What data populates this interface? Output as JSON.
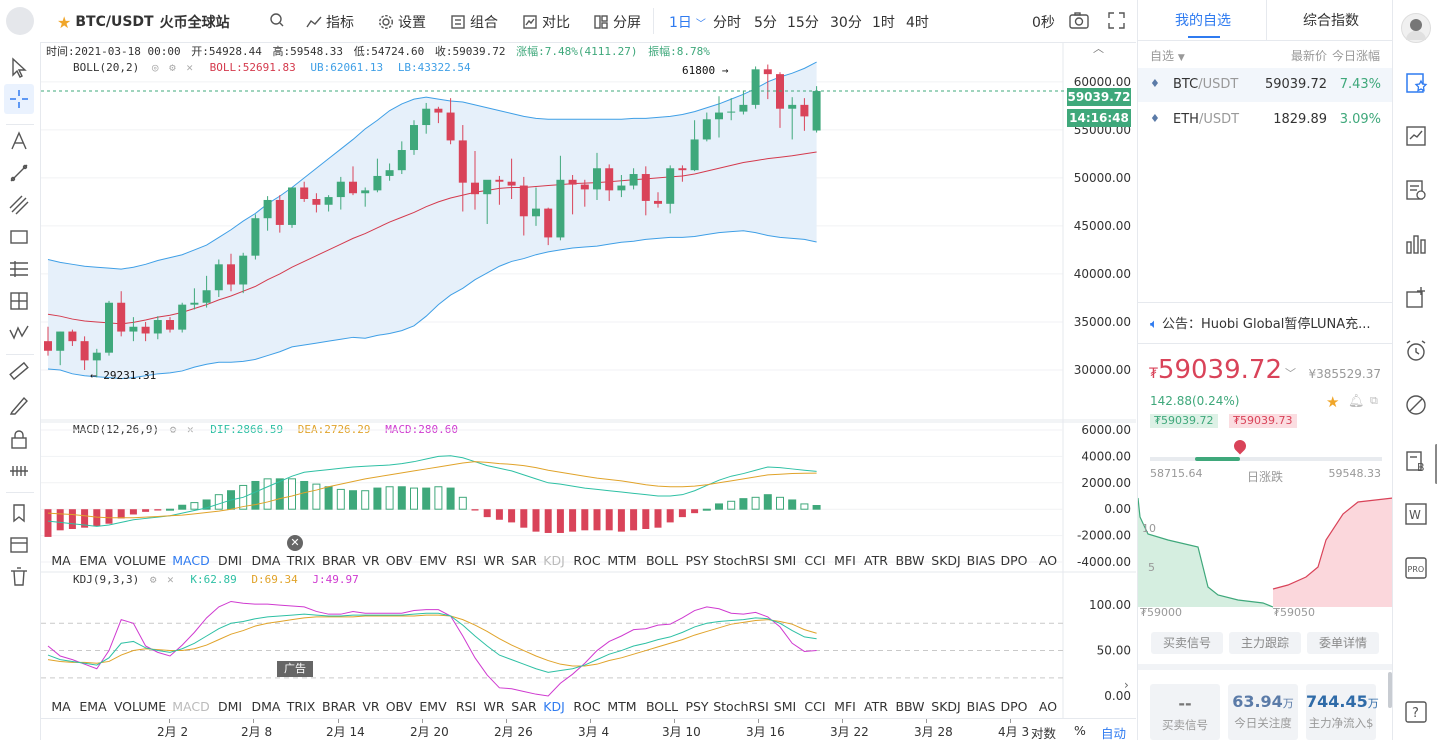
{
  "toolbar": {
    "symbol": "BTC/USDT",
    "exchange": "火币全球站",
    "indicators": "指标",
    "settings": "设置",
    "combo": "组合",
    "compare": "对比",
    "split": "分屏",
    "periods": [
      "1日",
      "分时",
      "5分",
      "15分",
      "30分",
      "1时",
      "4时"
    ],
    "active_period": "1日",
    "seconds": "0秒"
  },
  "ohlc": {
    "time": "时间:2021-03-18 00:00",
    "open": "开:54928.44",
    "high": "高:59548.33",
    "low": "低:54724.60",
    "close": "收:59039.72",
    "change": "涨幅:7.48%(4111.27)",
    "amplitude": "振幅:8.78%"
  },
  "boll": {
    "name": "BOLL(20,2)",
    "boll": "BOLL:52691.83",
    "ub": "UB:62061.13",
    "lb": "LB:43322.54"
  },
  "macd": {
    "name": "MACD(12,26,9)",
    "dif": "DIF:2866.59",
    "dea": "DEA:2726.29",
    "macd": "MACD:280.60"
  },
  "kdj": {
    "name": "KDJ(9,3,3)",
    "k": "K:62.89",
    "d": "D:69.34",
    "j": "J:49.97"
  },
  "price_axis": [
    "60000.00",
    "55000.00",
    "50000.00",
    "45000.00",
    "40000.00",
    "35000.00",
    "30000.00"
  ],
  "macd_axis": [
    "6000.00",
    "4000.00",
    "2000.00",
    "0.00",
    "-2000.00",
    "-4000.00"
  ],
  "kdj_axis": [
    "100.00",
    "50.00",
    "0.00"
  ],
  "price_label": "59039.72",
  "countdown": "14:16:48",
  "high_mark": "61800 →",
  "low_mark": "← 29231.31",
  "ad_label": "广告",
  "indicator_list": [
    "MA",
    "EMA",
    "VOLUME",
    "MACD",
    "DMI",
    "DMA",
    "TRIX",
    "BRAR",
    "VR",
    "OBV",
    "EMV",
    "RSI",
    "WR",
    "SAR",
    "KDJ",
    "ROC",
    "MTM",
    "BOLL",
    "PSY",
    "StochRSI",
    "SMI",
    "CCI",
    "MFI",
    "ATR",
    "BBW",
    "SKDJ",
    "BIAS",
    "DPO",
    "AO"
  ],
  "date_axis": [
    "2月 2",
    "2月 8",
    "2月 14",
    "2月 20",
    "2月 26",
    "3月 4",
    "3月 10",
    "3月 16",
    "3月 22",
    "3月 28",
    "4月 3"
  ],
  "bottom_right": {
    "log": "对数",
    "pct": "%",
    "auto": "自动"
  },
  "chart_data": {
    "type": "candlestick",
    "symbol": "BTC/USDT",
    "ylim": [
      25000,
      63000
    ],
    "candles": [
      [
        33000,
        34500,
        31500,
        32000
      ],
      [
        32000,
        34000,
        30500,
        34000
      ],
      [
        34000,
        34200,
        32500,
        33000
      ],
      [
        33000,
        33500,
        30000,
        31000
      ],
      [
        31000,
        32200,
        29231,
        31800
      ],
      [
        31800,
        37200,
        31500,
        37000
      ],
      [
        37000,
        38200,
        33500,
        34000
      ],
      [
        34000,
        35500,
        33000,
        34500
      ],
      [
        34500,
        35000,
        33000,
        33800
      ],
      [
        33800,
        35600,
        33200,
        35200
      ],
      [
        35200,
        35500,
        33900,
        34200
      ],
      [
        34200,
        37000,
        33900,
        36800
      ],
      [
        36800,
        38500,
        36300,
        37000
      ],
      [
        37000,
        39800,
        36500,
        38300
      ],
      [
        38300,
        41500,
        37600,
        41000
      ],
      [
        41000,
        42100,
        38200,
        38900
      ],
      [
        38900,
        42200,
        38000,
        41900
      ],
      [
        41900,
        46200,
        41500,
        45800
      ],
      [
        45800,
        48100,
        44500,
        47700
      ],
      [
        47700,
        48200,
        44300,
        45100
      ],
      [
        45100,
        49000,
        44800,
        49000
      ],
      [
        49000,
        49600,
        47500,
        47800
      ],
      [
        47800,
        48400,
        46400,
        47200
      ],
      [
        47200,
        48200,
        46500,
        48000
      ],
      [
        48000,
        50100,
        46700,
        49600
      ],
      [
        49600,
        51200,
        48200,
        48400
      ],
      [
        48400,
        49000,
        47000,
        48700
      ],
      [
        48700,
        52000,
        48500,
        50200
      ],
      [
        50200,
        51500,
        49700,
        50800
      ],
      [
        50800,
        53800,
        50400,
        52900
      ],
      [
        52900,
        56000,
        52400,
        55500
      ],
      [
        55500,
        57800,
        54600,
        57200
      ],
      [
        57200,
        57400,
        55700,
        56800
      ],
      [
        56800,
        58300,
        53500,
        53900
      ],
      [
        53900,
        55500,
        46500,
        49500
      ],
      [
        49500,
        52800,
        46700,
        48300
      ],
      [
        48300,
        49500,
        45200,
        49800
      ],
      [
        49800,
        50200,
        47200,
        49600
      ],
      [
        49600,
        52000,
        47800,
        49200
      ],
      [
        49200,
        50100,
        44000,
        46000
      ],
      [
        46000,
        49000,
        45000,
        46800
      ],
      [
        46800,
        46900,
        43000,
        43800
      ],
      [
        43800,
        52300,
        43500,
        49800
      ],
      [
        49800,
        50300,
        46200,
        49300
      ],
      [
        49300,
        49800,
        47000,
        48800
      ],
      [
        48800,
        52600,
        47700,
        51000
      ],
      [
        51000,
        51400,
        47600,
        48700
      ],
      [
        48700,
        50300,
        48000,
        49200
      ],
      [
        49200,
        51000,
        48800,
        50400
      ],
      [
        50400,
        51200,
        46100,
        47600
      ],
      [
        47600,
        48500,
        46900,
        47300
      ],
      [
        47300,
        51300,
        46300,
        51000
      ],
      [
        51000,
        51300,
        49600,
        50800
      ],
      [
        50800,
        56000,
        50700,
        54000
      ],
      [
        54000,
        56800,
        53800,
        56100
      ],
      [
        56100,
        58500,
        54200,
        56800
      ],
      [
        56800,
        58300,
        56000,
        56900
      ],
      [
        56900,
        59100,
        56600,
        57600
      ],
      [
        57600,
        61600,
        57200,
        61300
      ],
      [
        61300,
        61800,
        58200,
        60800
      ],
      [
        60800,
        61000,
        55200,
        57200
      ],
      [
        57200,
        58400,
        54000,
        57600
      ],
      [
        57600,
        58300,
        54900,
        56400
      ],
      [
        54930,
        59550,
        54720,
        59040
      ]
    ],
    "boll_mid": [
      35800,
      35600,
      35300,
      35100,
      35000,
      34900,
      34800,
      34950,
      35200,
      35500,
      35700,
      36000,
      36400,
      36800,
      37300,
      37700,
      38200,
      38700,
      39400,
      40000,
      40700,
      41300,
      41900,
      42500,
      43100,
      43700,
      44200,
      44800,
      45400,
      45900,
      46400,
      47000,
      47500,
      47900,
      48200,
      48500,
      48700,
      48900,
      49000,
      49000,
      49100,
      49200,
      49300,
      49400,
      49450,
      49500,
      49600,
      49700,
      49800,
      49900,
      50000,
      50100,
      50200,
      50400,
      50700,
      51000,
      51300,
      51600,
      51800,
      52000,
      52150,
      52300,
      52500,
      52690
    ],
    "boll_ub": [
      41500,
      41200,
      41000,
      40800,
      40700,
      40600,
      40500,
      40700,
      41000,
      41400,
      41700,
      42000,
      42500,
      43000,
      43800,
      44600,
      45500,
      46300,
      47300,
      48100,
      49000,
      50000,
      51000,
      52000,
      53000,
      54000,
      55100,
      56000,
      57000,
      57700,
      58200,
      58400,
      58200,
      58000,
      57900,
      57600,
      57300,
      57000,
      56700,
      56400,
      56200,
      56100,
      56100,
      56100,
      56100,
      56100,
      56100,
      56100,
      56200,
      56200,
      56300,
      56400,
      56600,
      56900,
      57300,
      57700,
      58200,
      58700,
      59300,
      60000,
      60500,
      60900,
      61400,
      62060
    ],
    "boll_lb": [
      30100,
      30000,
      29600,
      29400,
      29300,
      29200,
      29100,
      29200,
      29400,
      29600,
      29700,
      29900,
      30300,
      30600,
      30800,
      30800,
      30900,
      31100,
      31500,
      31900,
      32400,
      32600,
      32800,
      33000,
      33200,
      33400,
      33300,
      33600,
      33800,
      34100,
      34600,
      35600,
      36800,
      37800,
      38500,
      39400,
      40100,
      40800,
      41300,
      41600,
      42000,
      42300,
      42500,
      42700,
      42800,
      42900,
      43100,
      43300,
      43400,
      43600,
      43700,
      43800,
      43800,
      43900,
      44100,
      44300,
      44400,
      44500,
      44300,
      44000,
      43800,
      43700,
      43600,
      43320
    ],
    "macd_dif": [
      -900,
      -1000,
      -1100,
      -1200,
      -1300,
      -1200,
      -1000,
      -800,
      -700,
      -600,
      -500,
      -300,
      -100,
      100,
      400,
      700,
      900,
      1300,
      1700,
      2100,
      2500,
      2800,
      2900,
      3000,
      3100,
      3200,
      3250,
      3300,
      3350,
      3450,
      3600,
      3800,
      4000,
      4050,
      3900,
      3600,
      3300,
      3100,
      2900,
      2600,
      2300,
      2000,
      1900,
      1750,
      1600,
      1500,
      1400,
      1300,
      1200,
      1100,
      1000,
      1000,
      1100,
      1400,
      1800,
      2200,
      2500,
      2700,
      2950,
      3200,
      3150,
      3050,
      2950,
      2870
    ],
    "macd_dea": [
      -300,
      -350,
      -400,
      -500,
      -600,
      -650,
      -650,
      -650,
      -600,
      -550,
      -500,
      -450,
      -350,
      -250,
      -150,
      0,
      200,
      350,
      550,
      800,
      1000,
      1250,
      1450,
      1700,
      1900,
      2100,
      2300,
      2450,
      2600,
      2750,
      2900,
      3050,
      3200,
      3350,
      3500,
      3600,
      3550,
      3450,
      3400,
      3300,
      3150,
      2950,
      2800,
      2650,
      2500,
      2350,
      2250,
      2150,
      2000,
      1850,
      1750,
      1700,
      1700,
      1750,
      1850,
      2000,
      2150,
      2300,
      2450,
      2600,
      2650,
      2700,
      2720,
      2730
    ],
    "macd_hist": [
      -2100,
      -1600,
      -1500,
      -1400,
      -1300,
      -1100,
      -700,
      -400,
      -200,
      -100,
      0,
      300,
      500,
      700,
      1100,
      1400,
      1800,
      2100,
      2300,
      2300,
      2300,
      2100,
      1900,
      1700,
      1500,
      1400,
      1400,
      1600,
      1700,
      1700,
      1600,
      1600,
      1700,
      1600,
      900,
      -100,
      -600,
      -800,
      -1000,
      -1400,
      -1700,
      -1800,
      -1800,
      -1700,
      -1600,
      -1600,
      -1600,
      -1700,
      -1600,
      -1500,
      -1400,
      -1000,
      -600,
      -300,
      0,
      400,
      600,
      800,
      900,
      1100,
      900,
      700,
      400,
      280
    ],
    "kdj_k": [
      45,
      40,
      38,
      36,
      34,
      42,
      58,
      60,
      53,
      50,
      48,
      52,
      58,
      66,
      74,
      80,
      82,
      85,
      87,
      88,
      89,
      90,
      89,
      88,
      88,
      89,
      89,
      89,
      89,
      89,
      90,
      91,
      91,
      88,
      78,
      66,
      55,
      45,
      40,
      35,
      30,
      26,
      28,
      30,
      34,
      40,
      46,
      50,
      55,
      58,
      62,
      65,
      70,
      76,
      80,
      82,
      83,
      84,
      86,
      85,
      80,
      72,
      65,
      63
    ],
    "kdj_d": [
      40,
      38,
      37,
      37,
      36,
      38,
      45,
      50,
      52,
      51,
      50,
      50,
      52,
      56,
      62,
      68,
      72,
      77,
      80,
      82,
      84,
      86,
      87,
      87,
      87,
      87,
      88,
      88,
      88,
      88,
      88,
      89,
      89,
      88,
      84,
      78,
      71,
      63,
      56,
      50,
      44,
      39,
      35,
      33,
      33,
      35,
      39,
      42,
      46,
      50,
      54,
      58,
      62,
      67,
      71,
      75,
      79,
      81,
      83,
      84,
      82,
      79,
      73,
      69
    ],
    "kdj_j": [
      55,
      44,
      40,
      35,
      30,
      50,
      84,
      80,
      55,
      48,
      44,
      56,
      70,
      86,
      98,
      104,
      102,
      101,
      101,
      100,
      99,
      98,
      93,
      90,
      90,
      93,
      91,
      91,
      91,
      91,
      94,
      95,
      95,
      88,
      66,
      42,
      23,
      9,
      8,
      5,
      2,
      0,
      14,
      24,
      36,
      50,
      60,
      66,
      73,
      74,
      78,
      79,
      86,
      94,
      98,
      96,
      91,
      90,
      92,
      87,
      76,
      58,
      49,
      50
    ]
  },
  "right": {
    "tabs": [
      "我的自选",
      "综合指数"
    ],
    "header": {
      "col1": "自选",
      "col2": "最新价",
      "col3": "今日涨幅"
    },
    "watchlist": [
      {
        "base": "BTC",
        "quote": "/USDT",
        "price": "59039.72",
        "change": "7.43%"
      },
      {
        "base": "ETH",
        "quote": "/USDT",
        "price": "1829.89",
        "change": "3.09%"
      }
    ],
    "notice": "公告：Huobi Global暂停LUNA充...",
    "currency_sign": "₮",
    "last_price": "59039.72",
    "cny_price": "¥385529.37",
    "delta": "142.88(0.24%)",
    "bid": "₮59039.72",
    "ask": "₮59039.73",
    "range_low": "58715.64",
    "range_high": "59548.33",
    "range_label": "日涨跌",
    "range_position": 0.39,
    "depth_labels": [
      "10",
      "5",
      "₮59000",
      "₮59050"
    ],
    "buttons": [
      "买卖信号",
      "主力跟踪",
      "委单详情"
    ],
    "stats": [
      {
        "value": "--",
        "unit": "",
        "label": "买卖信号"
      },
      {
        "value": "63.94",
        "unit": "万",
        "label": "今日关注度"
      },
      {
        "value": "744.45",
        "unit": "万",
        "label": "主力净流入$"
      }
    ]
  },
  "sidebar_icons": [
    "watchlist-icon",
    "market-icon",
    "news-icon",
    "data-icon",
    "add-icon",
    "alarm-icon",
    "explore-icon",
    "B-icon",
    "W-icon",
    "PRO-icon",
    "help-icon"
  ],
  "colors": {
    "up": "#3fa87b",
    "down": "#d94359",
    "accent": "#2f7bf0",
    "boll_fill": "#e6f0fa",
    "boll_band": "#3f9fe6",
    "boll_mid": "#d43a4d",
    "dif": "#2ec0a4",
    "dea": "#e0a32a",
    "kdj_k": "#2ec0a4",
    "kdj_d": "#e0a32a",
    "kdj_j": "#cf3ad0"
  }
}
